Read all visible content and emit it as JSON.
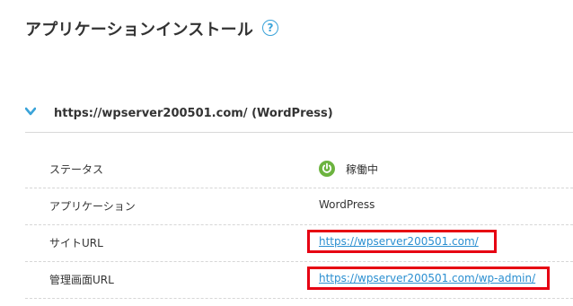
{
  "page": {
    "title": "アプリケーションインストール",
    "help_glyph": "?"
  },
  "section": {
    "title": "https://wpserver200501.com/ (WordPress)",
    "expanded": true
  },
  "rows": [
    {
      "label": "ステータス",
      "value": "稼働中",
      "type": "status"
    },
    {
      "label": "アプリケーション",
      "value": "WordPress",
      "type": "text"
    },
    {
      "label": "サイトURL",
      "value": "https://wpserver200501.com/",
      "type": "link"
    },
    {
      "label": "管理画面URL",
      "value": "https://wpserver200501.com/wp-admin/",
      "type": "link"
    }
  ],
  "colors": {
    "status_green": "#6cb33f",
    "link_blue": "#2b8fd1",
    "highlight_red": "#e60012",
    "help_blue": "#3aa3d9",
    "chevron_blue": "#3aa3d9"
  },
  "icons": {
    "help": "question-circle-icon",
    "chevron": "chevron-down-icon",
    "status": "power-icon"
  }
}
